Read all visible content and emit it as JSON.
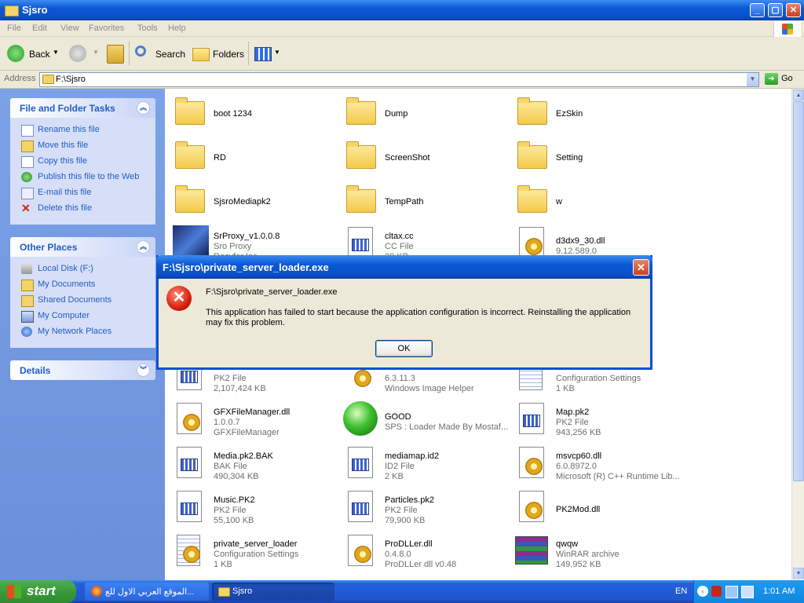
{
  "window": {
    "title": "Sjsro"
  },
  "menu": [
    "File",
    "Edit",
    "View",
    "Favorites",
    "Tools",
    "Help"
  ],
  "toolbar": {
    "back": "Back",
    "search": "Search",
    "folders": "Folders"
  },
  "address": {
    "label": "Address",
    "value": "F:\\Sjsro",
    "go": "Go"
  },
  "tasks": {
    "title": "File and Folder Tasks",
    "items": [
      "Rename this file",
      "Move this file",
      "Copy this file",
      "Publish this file to the Web",
      "E-mail this file",
      "Delete this file"
    ]
  },
  "places": {
    "title": "Other Places",
    "items": [
      "Local Disk (F:)",
      "My Documents",
      "Shared Documents",
      "My Computer",
      "My Network Places"
    ]
  },
  "details": {
    "title": "Details"
  },
  "files": {
    "boot": {
      "name": "boot 1234"
    },
    "dump": {
      "name": "Dump"
    },
    "ezskin": {
      "name": "EzSkin"
    },
    "rd": {
      "name": "RD"
    },
    "screenshot": {
      "name": "ScreenShot"
    },
    "setting": {
      "name": "Setting"
    },
    "sjsromedia": {
      "name": "SjsroMediapk2"
    },
    "temppath": {
      "name": "TempPath"
    },
    "w": {
      "name": "w"
    },
    "srproxy": {
      "name": "SrProxy_v1.0.0.8",
      "l2": "Sro Proxy",
      "l3": "Recyfer Inc."
    },
    "cltax": {
      "name": "cltax.cc",
      "l2": "CC File",
      "l3": "20 KB"
    },
    "d3dx9": {
      "name": "d3dx9_30.dll",
      "l2": "9.12.589.0"
    },
    "pk2a": {
      "l2": "PK2 File",
      "l3": "2,107,424 KB"
    },
    "imghelper": {
      "l2": "6.3.11.3",
      "l3": "Windows Image Helper"
    },
    "cfgsettings": {
      "l2": "Configuration Settings",
      "l3": "1 KB"
    },
    "gfx": {
      "name": "GFXFileManager.dll",
      "l2": "1.0.0.7",
      "l3": "GFXFileManager"
    },
    "good": {
      "name": "GOOD",
      "l2": "SPS : Loader Made By Mostaf..."
    },
    "map": {
      "name": "Map.pk2",
      "l2": "PK2 File",
      "l3": "943,256 KB"
    },
    "mediabak": {
      "name": "Media.pk2.BAK",
      "l2": "BAK File",
      "l3": "490,304 KB"
    },
    "mediamap": {
      "name": "mediamap.id2",
      "l2": "ID2 File",
      "l3": "2 KB"
    },
    "msvcp": {
      "name": "msvcp60.dll",
      "l2": "6.0.8972.0",
      "l3": "Microsoft (R) C++ Runtime Lib..."
    },
    "music": {
      "name": "Music.PK2",
      "l2": "PK2 File",
      "l3": "55,100 KB"
    },
    "particles": {
      "name": "Particles.pk2",
      "l2": "PK2 File",
      "l3": "79,900 KB"
    },
    "pk2mod": {
      "name": "PK2Mod.dll"
    },
    "psloader": {
      "name": "private_server_loader",
      "l2": "Configuration Settings",
      "l3": "1 KB"
    },
    "prodller": {
      "name": "ProDLLer.dll",
      "l2": "0.4.8.0",
      "l3": "ProDLLer dll v0.48"
    },
    "qwqw": {
      "name": "qwqw",
      "l2": "WinRAR archive",
      "l3": "149,952 KB"
    }
  },
  "dialog": {
    "title": "F:\\Sjsro\\private_server_loader.exe",
    "path": "F:\\Sjsro\\private_server_loader.exe",
    "message": "This application has failed to start because the application configuration is incorrect. Reinstalling the application may fix this problem.",
    "ok": "OK"
  },
  "taskbar": {
    "start": "start",
    "items": [
      "الموقع العربي الاول للع...",
      "Sjsro"
    ],
    "lang": "EN",
    "clock": "1:01 AM"
  }
}
